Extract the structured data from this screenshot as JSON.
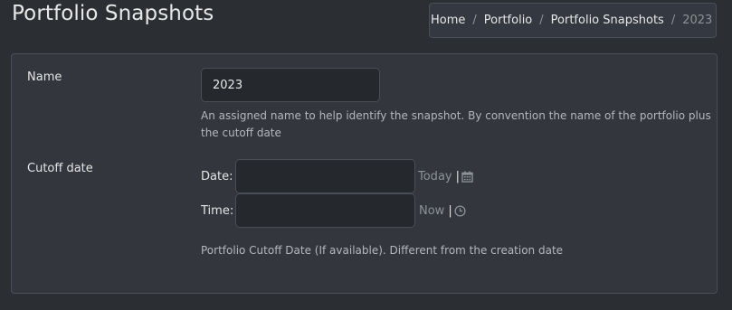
{
  "header": {
    "title": "Portfolio Snapshots"
  },
  "breadcrumb": {
    "items": [
      {
        "label": "Home"
      },
      {
        "label": "Portfolio"
      },
      {
        "label": "Portfolio Snapshots"
      },
      {
        "label": "2023"
      }
    ],
    "separator": "/"
  },
  "form": {
    "name": {
      "label": "Name",
      "value": "2023",
      "help_line1": "An assigned name to help identify the snapshot. By convention the name of the portfolio plus",
      "help_line2": "the cutoff date"
    },
    "cutoff": {
      "label": "Cutoff date",
      "date_label": "Date:",
      "date_value": "",
      "today_link": "Today",
      "date_icon": "calendar-icon",
      "time_label": "Time:",
      "time_value": "",
      "now_link": "Now",
      "time_icon": "clock-icon",
      "divider": "|",
      "help": "Portfolio Cutoff Date (If available). Different from the creation date"
    }
  },
  "colors": {
    "background": "#2b2e33",
    "card": "#33363d",
    "input": "#25282d",
    "border": "#4a4e56",
    "muted": "#8d9299"
  }
}
